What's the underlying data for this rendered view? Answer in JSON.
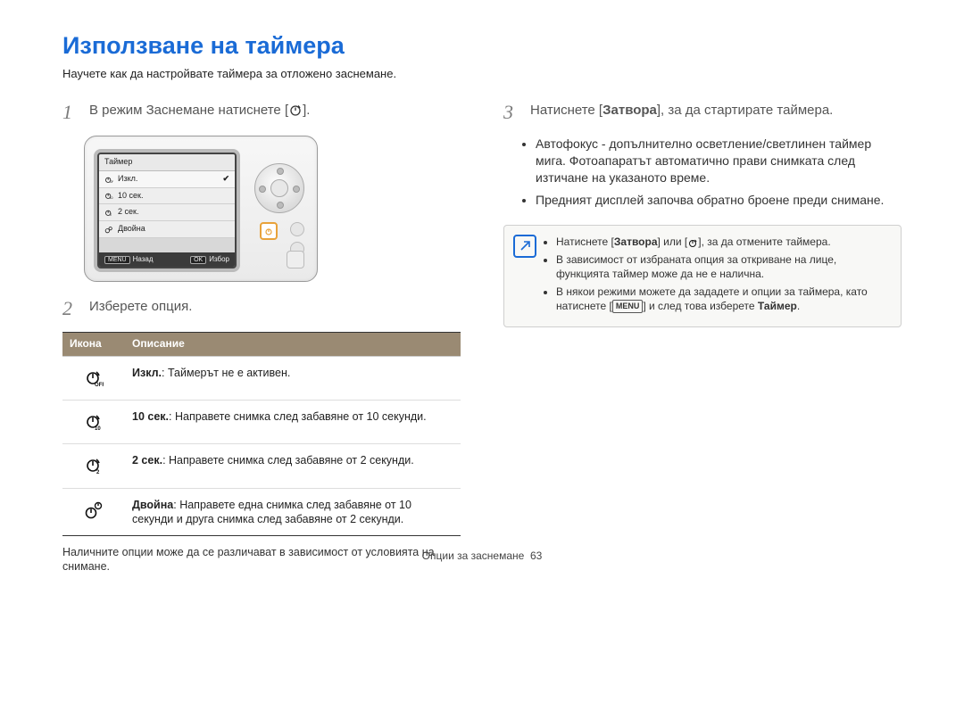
{
  "page": {
    "title": "Използване на таймера",
    "intro": "Научете как да настройвате таймера за отложено заснемане.",
    "footer_label": "Опции за заснемане",
    "footer_page": "63"
  },
  "left": {
    "step1_text": "В режим Заснемане натиснете [",
    "step1_suffix": "].",
    "step2_text": "Изберете опция.",
    "lcd": {
      "title": "Таймер",
      "rows": [
        {
          "label": "Изкл.",
          "sub": "OFF",
          "selected": true
        },
        {
          "label": "10 сек.",
          "sub": "10"
        },
        {
          "label": "2 сек.",
          "sub": "2"
        },
        {
          "label": "Двойна",
          "sub": ""
        }
      ],
      "back_tag": "MENU",
      "back_label": "Назад",
      "ok_tag": "OK",
      "ok_label": "Избор"
    },
    "table": {
      "head_icon": "Икона",
      "head_desc": "Описание",
      "rows": [
        {
          "icon": "off",
          "bold": "Изкл.",
          "rest": ": Таймерът не е активен."
        },
        {
          "icon": "ten",
          "bold": "10 сек.",
          "rest": ": Направете снимка след забавяне от 10 секунди."
        },
        {
          "icon": "two",
          "bold": "2 сек.",
          "rest": ": Направете снимка след забавяне от 2 секунди."
        },
        {
          "icon": "double",
          "bold": "Двойна",
          "rest": ": Направете една снимка след забавяне от 10 секунди и друга снимка след забавяне от 2 секунди."
        }
      ]
    },
    "footnote": "Наличните опции може да се различават в зависимост от условията на снимане."
  },
  "right": {
    "step3_prefix": "Натиснете [",
    "step3_bold": "Затвора",
    "step3_suffix": "], за да стартирате таймера.",
    "bullets": [
      "Автофокус - допълнително осветление/светлинен таймер мига. Фотоапаратът автоматично прави снимката след изтичане на указаното време.",
      "Предният дисплей започва обратно броене преди снимане."
    ],
    "note": {
      "item1_prefix": "Натиснете [",
      "item1_bold": "Затвора",
      "item1_mid": "] или [",
      "item1_suffix": "], за да отмените таймера.",
      "item2": "В зависимост от избраната опция за откриване на лице, функцията таймер може да не е налична.",
      "item3_prefix": "В някои режими можете да зададете и опции за таймера, като натиснете [",
      "item3_tag": "MENU",
      "item3_mid": "] и след това изберете ",
      "item3_bold": "Таймер",
      "item3_suffix": "."
    }
  }
}
